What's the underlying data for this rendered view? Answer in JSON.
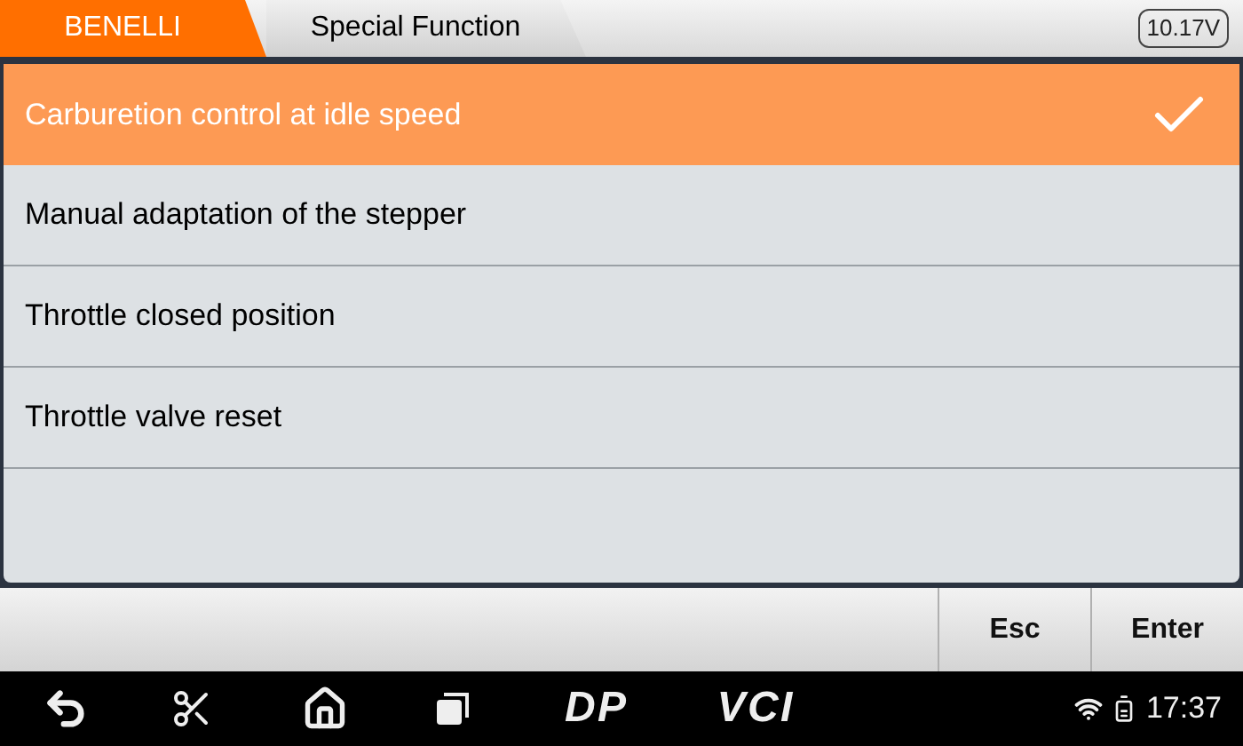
{
  "breadcrumbs": [
    {
      "label": "BENELLI",
      "selected": true
    },
    {
      "label": "Special Function",
      "selected": false
    }
  ],
  "voltage": "10.17V",
  "items": [
    {
      "label": "Carburetion control at idle speed",
      "selected": true
    },
    {
      "label": "Manual adaptation of the stepper",
      "selected": false
    },
    {
      "label": "Throttle closed position",
      "selected": false
    },
    {
      "label": "Throttle valve reset",
      "selected": false
    }
  ],
  "buttons": [
    "Esc",
    "Enter"
  ],
  "nav_bar": {
    "dp_label": "DP",
    "vci_label": "VCI",
    "time": "17:37"
  }
}
